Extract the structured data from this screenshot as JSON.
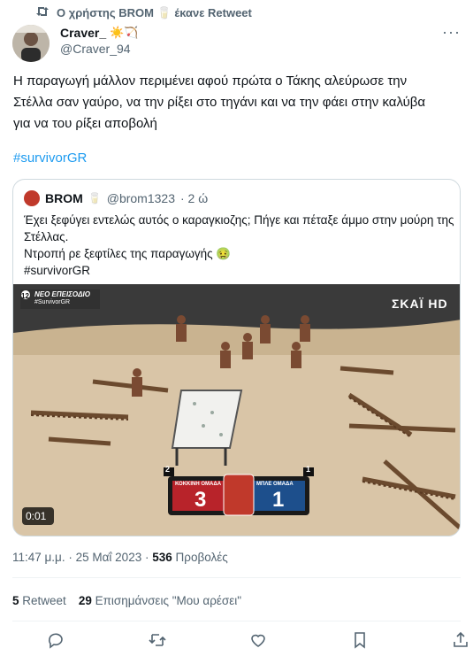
{
  "retweet_header": {
    "text": "Ο χρήστης BROM 🥛 έκανε Retweet"
  },
  "author": {
    "name": "Craver_",
    "name_emoji": "☀️🏹",
    "handle": "@Craver_94"
  },
  "tweet": {
    "lines": [
      "Η παραγωγή μάλλον περιμένει αφού πρώτα ο Τάκης αλεύρωσε την",
      "Στέλλα σαν γαύρο, να την ρίξει στο τηγάνι και να την φάει στην καλύβα",
      "για να του ρίξει αποβολή"
    ],
    "hashtag": "#survivorGR"
  },
  "quoted": {
    "name": "BROM",
    "badge": "🥛",
    "handle": "@brom1323",
    "time": "· 2 ώ",
    "lines": [
      "Έχει ξεφύγει εντελώς αυτός ο καραγκιοζης; Πήγε και πέταξε άμμο στην μούρη της",
      "Στέλλας.",
      "Ντροπή ρε ξεφτίλες της παραγωγής 🤢"
    ],
    "hashtag": "#survivorGR",
    "video": {
      "channel_logo": "ΣΚΑΪ HD",
      "overlay_text_1": "ΝΕΟ ΕΠΕΙΣΟΔΙΟ",
      "overlay_text_2": "#SurvivorGR",
      "overlay_badge": "12",
      "team_left_name": "ΚΟΚΚΙΝΗ ΟΜΑΔΑ",
      "team_left_score": "3",
      "team_left_rank": "2",
      "team_right_name": "ΜΠΛΕ ΟΜΑΔΑ",
      "team_right_score": "1",
      "team_right_rank": "1",
      "duration": "0:01"
    }
  },
  "meta": {
    "time": "11:47 μ.μ.",
    "date": "25 Μαΐ 2023",
    "views": "536",
    "views_label": "Προβολές"
  },
  "stats": {
    "retweets": "5",
    "retweets_label": "Retweet",
    "likes": "29",
    "likes_label": "Επισημάνσεις \"Μου αρέσει\""
  },
  "colors": {
    "link": "#1d9bf0",
    "muted": "#536471",
    "border": "#cfd9de"
  }
}
